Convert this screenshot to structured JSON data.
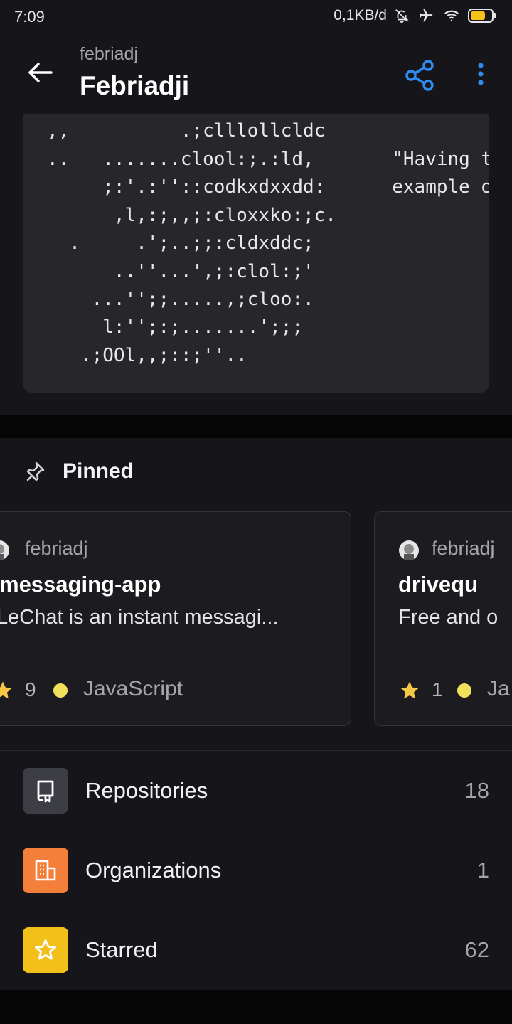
{
  "status_bar": {
    "time": "7:09",
    "network_speed": "0,1KB/d",
    "icons": [
      "muted-bell-icon",
      "airplane-icon",
      "wifi-icon",
      "battery-icon"
    ]
  },
  "app_bar": {
    "username": "febriadj",
    "display_name": "Febriadji",
    "icons": [
      "back-arrow-icon",
      "share-icon",
      "more-vert-icon"
    ]
  },
  "readme": {
    "lines": [
      ",,          .;clllollcldc",
      "..   .......clool:;.:ld,       \"Having t",
      "     ;:'.:''::codkxdxxdd:      example o",
      "      ,l,:;,,;:cloxxko:;c.",
      "  .     .';..;;:cldxddc;",
      "      ..''...',;:clol:;'",
      "    ...'';;.....,;cloo:.",
      "     l:'';:;.......';;;",
      "   .;OOl,,;::;''.."
    ]
  },
  "pinned": {
    "title": "Pinned",
    "repos": [
      {
        "owner": "febriadj",
        "name": "messaging-app",
        "description": "LeChat is an instant messagi...",
        "stars": "9",
        "language": "JavaScript",
        "language_color": "#f1e05a"
      },
      {
        "owner": "febriadj",
        "name": "drivequ",
        "description": "Free and o",
        "stars": "1",
        "language": "Ja",
        "language_color": "#f1e05a"
      }
    ]
  },
  "profile_list": [
    {
      "label": "Repositories",
      "count": "18",
      "icon": "repo-icon",
      "color": "#3d3d45"
    },
    {
      "label": "Organizations",
      "count": "1",
      "icon": "organization-icon",
      "color": "#f47f3a"
    },
    {
      "label": "Starred",
      "count": "62",
      "icon": "star-outline-icon",
      "color": "#f2bf1b"
    }
  ],
  "colors": {
    "accent": "#2f8cf0",
    "star": "#f6c744"
  }
}
